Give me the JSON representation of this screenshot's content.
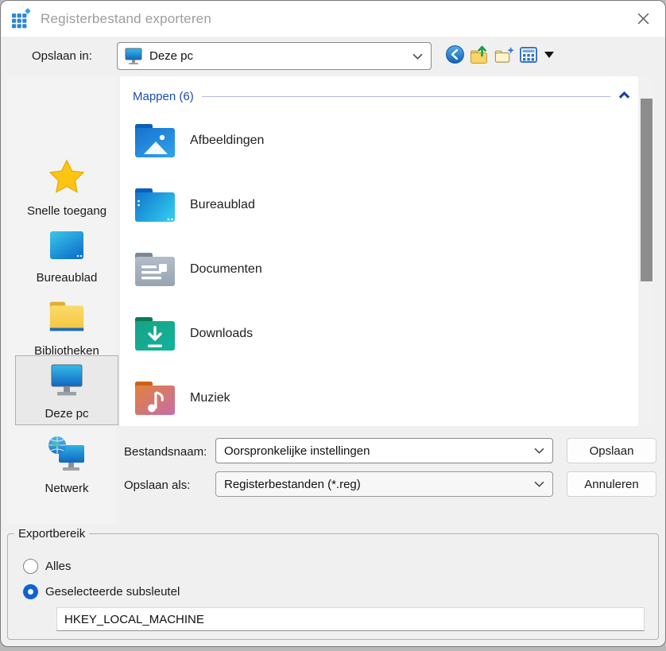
{
  "window": {
    "title": "Registerbestand exporteren",
    "close_glyph": "✕",
    "app_icon": "registry-icon"
  },
  "location_bar": {
    "label": "Opslaan in:",
    "value": "Deze pc",
    "icons": [
      "back-icon",
      "up-one-level-icon",
      "new-folder-icon",
      "view-menu-icon"
    ]
  },
  "sidebar": {
    "items": [
      {
        "label": "Snelle toegang",
        "icon": "star-icon",
        "selected": false
      },
      {
        "label": "Bureaublad",
        "icon": "desktop-icon",
        "selected": false
      },
      {
        "label": "Bibliotheken",
        "icon": "libraries-folder-icon",
        "selected": false
      },
      {
        "label": "Deze pc",
        "icon": "this-pc-icon",
        "selected": true
      },
      {
        "label": "Netwerk",
        "icon": "network-icon",
        "selected": false
      }
    ]
  },
  "folders": {
    "header": "Mappen (6)",
    "collapse_icon": "chevron-up-icon",
    "items": [
      {
        "name": "Afbeeldingen",
        "icon": "pictures-folder-icon"
      },
      {
        "name": "Bureaublad",
        "icon": "desktop-folder-icon"
      },
      {
        "name": "Documenten",
        "icon": "documents-folder-icon"
      },
      {
        "name": "Downloads",
        "icon": "downloads-folder-icon"
      },
      {
        "name": "Muziek",
        "icon": "music-folder-icon"
      }
    ]
  },
  "form": {
    "filename_label": "Bestandsnaam:",
    "filename_value": "Oorspronkelijke instellingen",
    "save_button": "Opslaan",
    "filetype_label": "Opslaan als:",
    "filetype_value": "Registerbestanden (*.reg)",
    "cancel_button": "Annuleren"
  },
  "export_range": {
    "legend": "Exportbereik",
    "options": [
      {
        "label": "Alles",
        "checked": false
      },
      {
        "label": "Geselecteerde subsleutel",
        "checked": true
      }
    ],
    "selected_key": "HKEY_LOCAL_MACHINE"
  },
  "colors": {
    "accent_blue": "#0e63d4",
    "section_header_blue": "#1b4ea8",
    "titlebar_bg": "#ffffff",
    "dialog_bg": "#f0f0f0"
  }
}
